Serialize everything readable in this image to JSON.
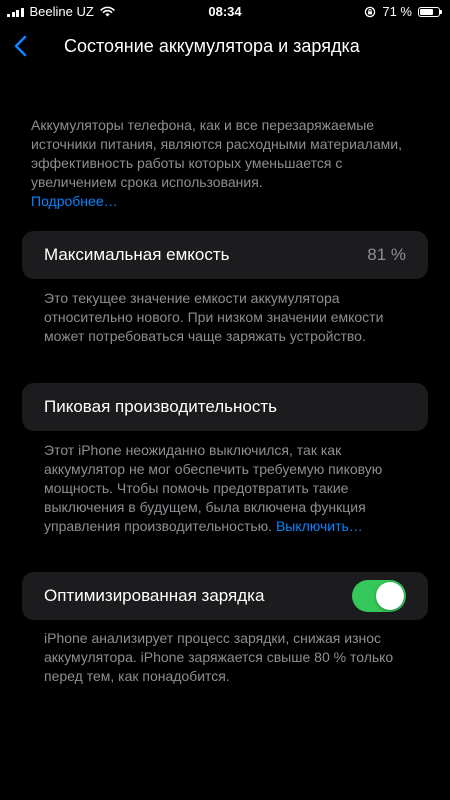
{
  "status_bar": {
    "carrier": "Beeline UZ",
    "time": "08:34",
    "battery_percent_label": "71 %",
    "battery_level": 0.71
  },
  "nav": {
    "title": "Состояние аккумулятора и зарядка"
  },
  "intro": {
    "text": "Аккумуляторы телефона, как и все перезаряжаемые источники питания, являются расходными материалами, эффективность работы которых уменьшается с увеличением срока использования.",
    "link": "Подробнее…"
  },
  "max_capacity": {
    "label": "Максимальная емкость",
    "value": "81 %",
    "footnote": "Это текущее значение емкости аккумулятора относительно нового. При низком значении емкости может потребоваться чаще заряжать устройство."
  },
  "peak_performance": {
    "label": "Пиковая производительность",
    "footnote": "Этот iPhone неожиданно выключился, так как аккумулятор не мог обеспечить требуемую пиковую мощность. Чтобы помочь предотвратить такие выключения в будущем, была включена функция управления производительностью.",
    "link": "Выключить…"
  },
  "optimized_charging": {
    "label": "Оптимизированная зарядка",
    "enabled": true,
    "footnote": "iPhone анализирует процесс зарядки, снижая износ аккумулятора. iPhone заряжается свыше 80 % только перед тем, как понадобится."
  },
  "colors": {
    "background": "#000000",
    "cell": "#1c1c1e",
    "secondary_text": "#8e8e93",
    "link": "#0a84ff",
    "toggle_on": "#34c759"
  }
}
